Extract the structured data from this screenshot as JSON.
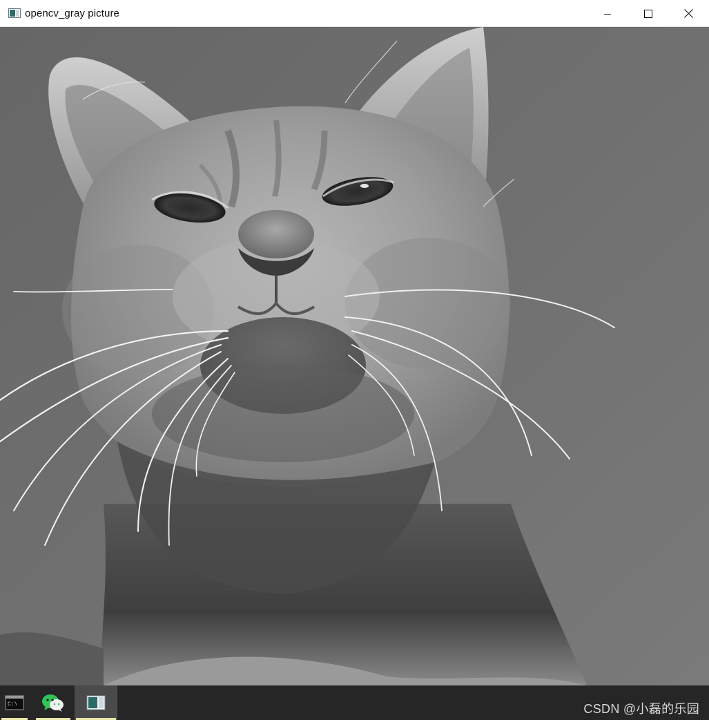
{
  "window": {
    "title": "opencv_gray picture",
    "app_icon": "opencv-window-icon",
    "controls": [
      "minimize-icon",
      "maximize-icon",
      "close-icon"
    ]
  },
  "image": {
    "subject": "grayscale cat portrait",
    "colors": {
      "background": "#6f6f6f",
      "fur": "#9a9a9a"
    }
  },
  "taskbar": {
    "items": [
      {
        "icon": "terminal-icon",
        "active": false
      },
      {
        "icon": "wechat-icon",
        "active": false
      },
      {
        "icon": "opencv-window-icon",
        "active": true
      }
    ],
    "underline_color": "#e8e6a8"
  },
  "watermark": "CSDN @小磊的乐园"
}
